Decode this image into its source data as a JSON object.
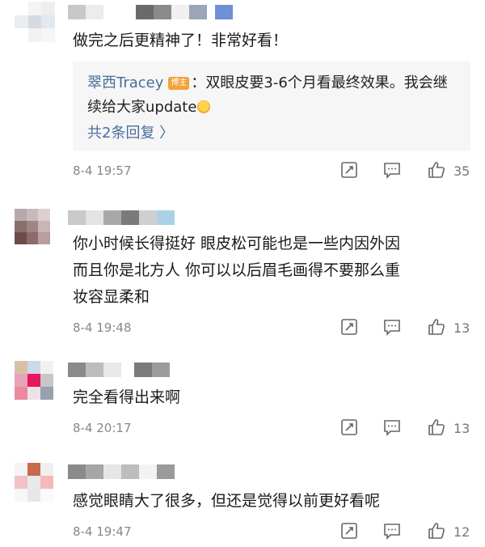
{
  "comments": [
    {
      "text": "做完之后更精神了！非常好看！",
      "reply": {
        "user": "翠西Tracey",
        "badge": "博主",
        "line1": "：双眼皮要3-6个月看最终效果。我会继",
        "line2": "续给大家update",
        "more": "共2条回复 〉"
      },
      "time": "8-4 19:57",
      "likes": "35"
    },
    {
      "line1": "你小时候长得挺好 眼皮松可能也是一些内因外因",
      "line2": "而且你是北方人 你可以以后眉毛画得不要那么重",
      "line3": "妆容显柔和",
      "time": "8-4 19:48",
      "likes": "13"
    },
    {
      "text": "完全看得出来啊",
      "time": "8-4 20:17",
      "likes": "13"
    },
    {
      "text": "感觉眼睛大了很多，但还是觉得以前更好看呢",
      "time": "8-4 19:47",
      "likes": "12"
    }
  ],
  "icons": {
    "repost": "repost-icon",
    "comment": "comment-icon",
    "like": "thumbs-up-icon"
  }
}
